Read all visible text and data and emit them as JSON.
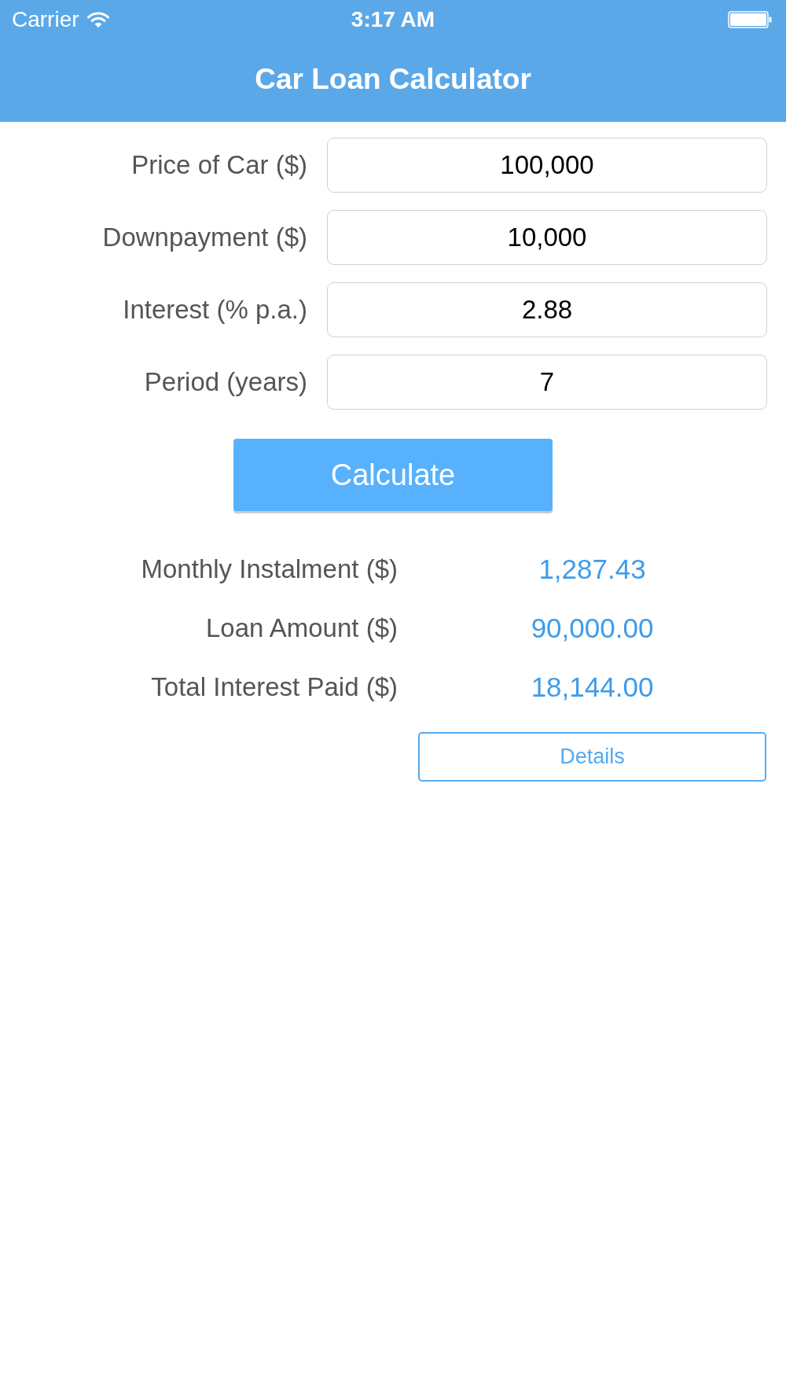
{
  "status_bar": {
    "carrier": "Carrier",
    "time": "3:17 AM"
  },
  "nav_bar": {
    "title": "Car Loan Calculator"
  },
  "inputs": [
    {
      "label": "Price of Car ($)",
      "value": "100,000"
    },
    {
      "label": "Downpayment ($)",
      "value": "10,000"
    },
    {
      "label": "Interest (% p.a.)",
      "value": "2.88"
    },
    {
      "label": "Period (years)",
      "value": "7"
    }
  ],
  "calculate_button": {
    "label": "Calculate"
  },
  "results": [
    {
      "label": "Monthly Instalment ($)",
      "value": "1,287.43"
    },
    {
      "label": "Loan Amount ($)",
      "value": "90,000.00"
    },
    {
      "label": "Total Interest Paid ($)",
      "value": "18,144.00"
    }
  ],
  "details_button": {
    "label": "Details"
  }
}
